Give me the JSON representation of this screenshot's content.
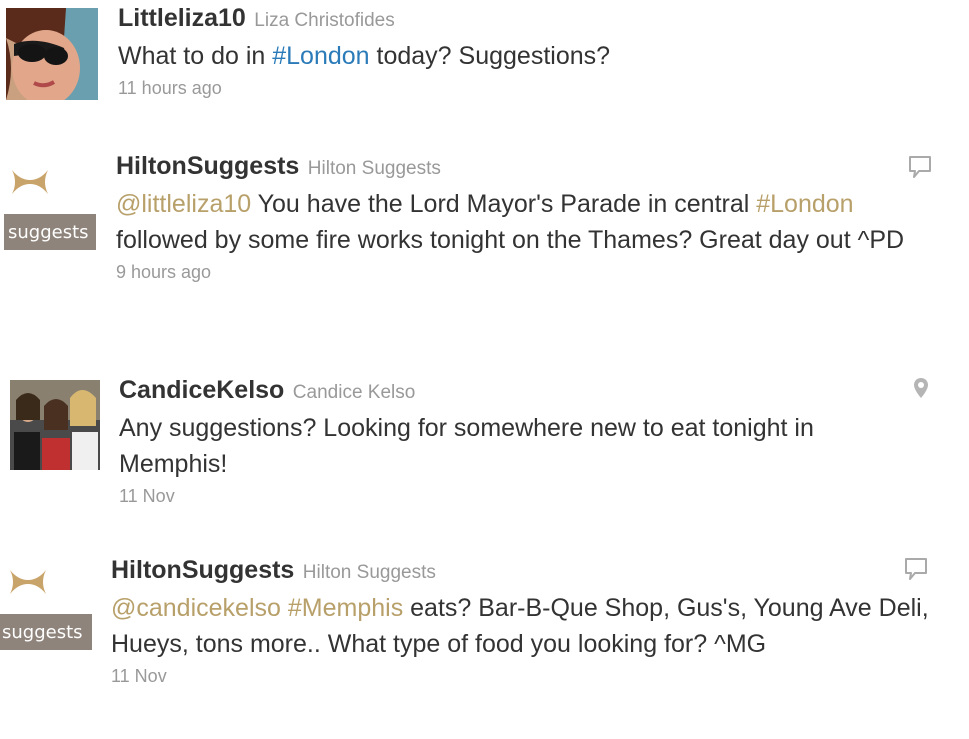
{
  "tweets": [
    {
      "screen_name": "Littleliza10",
      "full_name": "Liza Christofides",
      "text_parts": [
        "What to do in ",
        "#London",
        " today? Suggestions?"
      ],
      "timestamp": "11 hours ago",
      "avatar": "profile-photo-woman-sunglasses",
      "action_icon": null
    },
    {
      "screen_name": "HiltonSuggests",
      "full_name": "Hilton Suggests",
      "text_parts": [
        "@littleliza10",
        " You have the Lord Mayor's Parade in central ",
        "#London",
        " followed by some fire works tonight on the Thames? Great day out ^PD"
      ],
      "timestamp": "9 hours ago",
      "avatar": "hilton-suggests-logo",
      "avatar_label": "suggests",
      "action_icon": "speech-bubble-icon"
    },
    {
      "screen_name": "CandiceKelso",
      "full_name": "Candice Kelso",
      "text_parts": [
        "Any suggestions? Looking for somewhere new to eat tonight in Memphis!"
      ],
      "timestamp": "11 Nov",
      "avatar": "profile-photo-group-women",
      "action_icon": "location-pin-icon"
    },
    {
      "screen_name": "HiltonSuggests",
      "full_name": "Hilton Suggests",
      "text_parts": [
        "@candicekelso",
        " ",
        "#Memphis",
        " eats? Bar-B-Que Shop, Gus's, Young Ave Deli, Hueys, tons more.. What type of food you looking for? ^MG"
      ],
      "timestamp": "11 Nov",
      "avatar": "hilton-suggests-logo",
      "avatar_label": "suggests",
      "action_icon": "speech-bubble-icon"
    }
  ],
  "colors": {
    "link_blue": "#2b7bb9",
    "link_gold": "#b8a06a",
    "hilton_band": "#8f847b",
    "hilton_h": "#c9a46a",
    "muted_text": "#999999"
  }
}
